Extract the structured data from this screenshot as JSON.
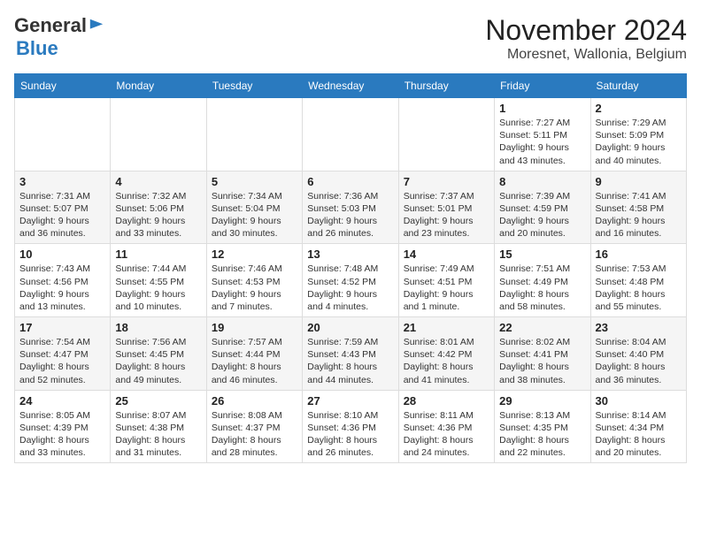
{
  "header": {
    "logo_general": "General",
    "logo_blue": "Blue",
    "month_year": "November 2024",
    "location": "Moresnet, Wallonia, Belgium"
  },
  "days_of_week": [
    "Sunday",
    "Monday",
    "Tuesday",
    "Wednesday",
    "Thursday",
    "Friday",
    "Saturday"
  ],
  "weeks": [
    [
      {
        "day": "",
        "info": ""
      },
      {
        "day": "",
        "info": ""
      },
      {
        "day": "",
        "info": ""
      },
      {
        "day": "",
        "info": ""
      },
      {
        "day": "",
        "info": ""
      },
      {
        "day": "1",
        "info": "Sunrise: 7:27 AM\nSunset: 5:11 PM\nDaylight: 9 hours\nand 43 minutes."
      },
      {
        "day": "2",
        "info": "Sunrise: 7:29 AM\nSunset: 5:09 PM\nDaylight: 9 hours\nand 40 minutes."
      }
    ],
    [
      {
        "day": "3",
        "info": "Sunrise: 7:31 AM\nSunset: 5:07 PM\nDaylight: 9 hours\nand 36 minutes."
      },
      {
        "day": "4",
        "info": "Sunrise: 7:32 AM\nSunset: 5:06 PM\nDaylight: 9 hours\nand 33 minutes."
      },
      {
        "day": "5",
        "info": "Sunrise: 7:34 AM\nSunset: 5:04 PM\nDaylight: 9 hours\nand 30 minutes."
      },
      {
        "day": "6",
        "info": "Sunrise: 7:36 AM\nSunset: 5:03 PM\nDaylight: 9 hours\nand 26 minutes."
      },
      {
        "day": "7",
        "info": "Sunrise: 7:37 AM\nSunset: 5:01 PM\nDaylight: 9 hours\nand 23 minutes."
      },
      {
        "day": "8",
        "info": "Sunrise: 7:39 AM\nSunset: 4:59 PM\nDaylight: 9 hours\nand 20 minutes."
      },
      {
        "day": "9",
        "info": "Sunrise: 7:41 AM\nSunset: 4:58 PM\nDaylight: 9 hours\nand 16 minutes."
      }
    ],
    [
      {
        "day": "10",
        "info": "Sunrise: 7:43 AM\nSunset: 4:56 PM\nDaylight: 9 hours\nand 13 minutes."
      },
      {
        "day": "11",
        "info": "Sunrise: 7:44 AM\nSunset: 4:55 PM\nDaylight: 9 hours\nand 10 minutes."
      },
      {
        "day": "12",
        "info": "Sunrise: 7:46 AM\nSunset: 4:53 PM\nDaylight: 9 hours\nand 7 minutes."
      },
      {
        "day": "13",
        "info": "Sunrise: 7:48 AM\nSunset: 4:52 PM\nDaylight: 9 hours\nand 4 minutes."
      },
      {
        "day": "14",
        "info": "Sunrise: 7:49 AM\nSunset: 4:51 PM\nDaylight: 9 hours\nand 1 minute."
      },
      {
        "day": "15",
        "info": "Sunrise: 7:51 AM\nSunset: 4:49 PM\nDaylight: 8 hours\nand 58 minutes."
      },
      {
        "day": "16",
        "info": "Sunrise: 7:53 AM\nSunset: 4:48 PM\nDaylight: 8 hours\nand 55 minutes."
      }
    ],
    [
      {
        "day": "17",
        "info": "Sunrise: 7:54 AM\nSunset: 4:47 PM\nDaylight: 8 hours\nand 52 minutes."
      },
      {
        "day": "18",
        "info": "Sunrise: 7:56 AM\nSunset: 4:45 PM\nDaylight: 8 hours\nand 49 minutes."
      },
      {
        "day": "19",
        "info": "Sunrise: 7:57 AM\nSunset: 4:44 PM\nDaylight: 8 hours\nand 46 minutes."
      },
      {
        "day": "20",
        "info": "Sunrise: 7:59 AM\nSunset: 4:43 PM\nDaylight: 8 hours\nand 44 minutes."
      },
      {
        "day": "21",
        "info": "Sunrise: 8:01 AM\nSunset: 4:42 PM\nDaylight: 8 hours\nand 41 minutes."
      },
      {
        "day": "22",
        "info": "Sunrise: 8:02 AM\nSunset: 4:41 PM\nDaylight: 8 hours\nand 38 minutes."
      },
      {
        "day": "23",
        "info": "Sunrise: 8:04 AM\nSunset: 4:40 PM\nDaylight: 8 hours\nand 36 minutes."
      }
    ],
    [
      {
        "day": "24",
        "info": "Sunrise: 8:05 AM\nSunset: 4:39 PM\nDaylight: 8 hours\nand 33 minutes."
      },
      {
        "day": "25",
        "info": "Sunrise: 8:07 AM\nSunset: 4:38 PM\nDaylight: 8 hours\nand 31 minutes."
      },
      {
        "day": "26",
        "info": "Sunrise: 8:08 AM\nSunset: 4:37 PM\nDaylight: 8 hours\nand 28 minutes."
      },
      {
        "day": "27",
        "info": "Sunrise: 8:10 AM\nSunset: 4:36 PM\nDaylight: 8 hours\nand 26 minutes."
      },
      {
        "day": "28",
        "info": "Sunrise: 8:11 AM\nSunset: 4:36 PM\nDaylight: 8 hours\nand 24 minutes."
      },
      {
        "day": "29",
        "info": "Sunrise: 8:13 AM\nSunset: 4:35 PM\nDaylight: 8 hours\nand 22 minutes."
      },
      {
        "day": "30",
        "info": "Sunrise: 8:14 AM\nSunset: 4:34 PM\nDaylight: 8 hours\nand 20 minutes."
      }
    ]
  ]
}
